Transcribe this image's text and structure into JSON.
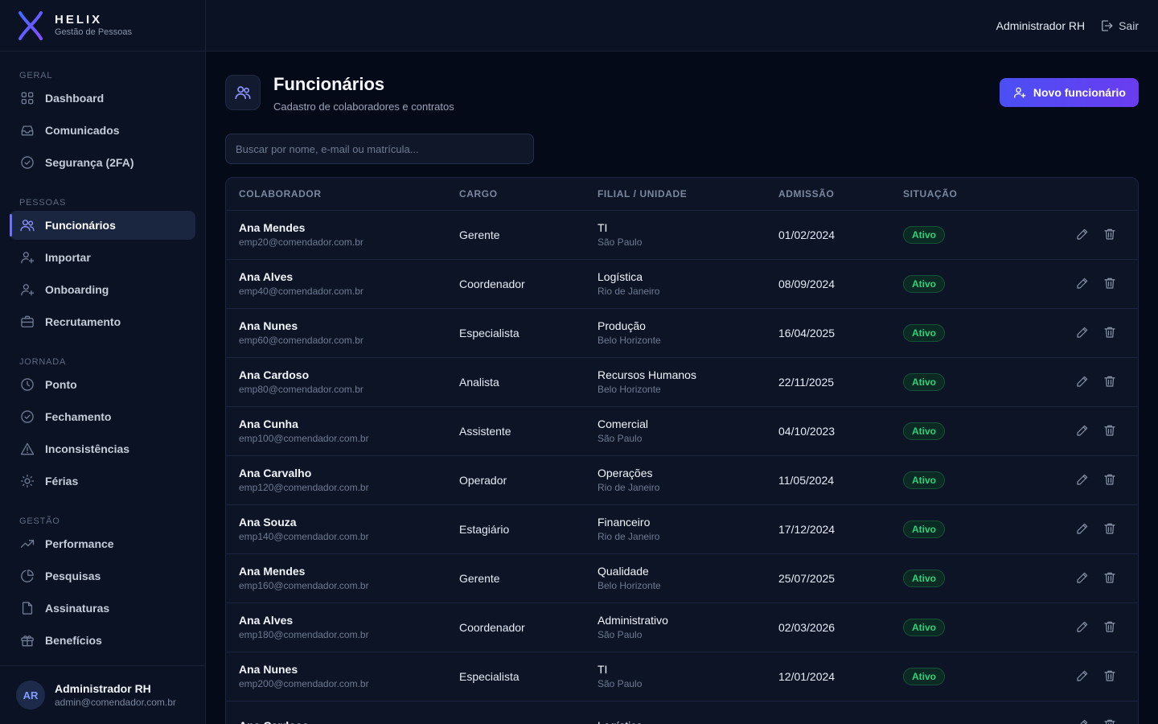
{
  "brand": {
    "name": "HELIX",
    "subtitle": "Gestão de Pessoas"
  },
  "topbar": {
    "user": "Administrador RH",
    "logout": "Sair"
  },
  "sidebar": {
    "sections": [
      {
        "label": "GERAL",
        "items": [
          {
            "label": "Dashboard",
            "icon": "grid-icon"
          },
          {
            "label": "Comunicados",
            "icon": "inbox-icon"
          },
          {
            "label": "Segurança (2FA)",
            "icon": "check-circle-icon"
          }
        ]
      },
      {
        "label": "PESSOAS",
        "items": [
          {
            "label": "Funcionários",
            "icon": "users-icon",
            "active": true
          },
          {
            "label": "Importar",
            "icon": "user-plus-icon"
          },
          {
            "label": "Onboarding",
            "icon": "user-plus-icon"
          },
          {
            "label": "Recrutamento",
            "icon": "briefcase-icon"
          }
        ]
      },
      {
        "label": "JORNADA",
        "items": [
          {
            "label": "Ponto",
            "icon": "clock-icon"
          },
          {
            "label": "Fechamento",
            "icon": "check-circle-icon"
          },
          {
            "label": "Inconsistências",
            "icon": "alert-triangle-icon"
          },
          {
            "label": "Férias",
            "icon": "sun-icon"
          }
        ]
      },
      {
        "label": "GESTÃO",
        "items": [
          {
            "label": "Performance",
            "icon": "trending-up-icon"
          },
          {
            "label": "Pesquisas",
            "icon": "pie-chart-icon"
          },
          {
            "label": "Assinaturas",
            "icon": "file-icon"
          },
          {
            "label": "Benefícios",
            "icon": "gift-icon"
          }
        ]
      }
    ],
    "user": {
      "initials": "AR",
      "name": "Administrador RH",
      "email": "admin@comendador.com.br"
    }
  },
  "page": {
    "title": "Funcionários",
    "subtitle": "Cadastro de colaboradores e contratos",
    "new_button": "Novo funcionário",
    "search_placeholder": "Buscar por nome, e-mail ou matrícula..."
  },
  "table": {
    "headers": [
      "COLABORADOR",
      "CARGO",
      "FILIAL / UNIDADE",
      "ADMISSÃO",
      "SITUAÇÃO"
    ],
    "rows": [
      {
        "name": "Ana Mendes",
        "email": "emp20@comendador.com.br",
        "role": "Gerente",
        "unit": "TI",
        "city": "São Paulo",
        "date": "01/02/2024",
        "status": "Ativo"
      },
      {
        "name": "Ana Alves",
        "email": "emp40@comendador.com.br",
        "role": "Coordenador",
        "unit": "Logística",
        "city": "Rio de Janeiro",
        "date": "08/09/2024",
        "status": "Ativo"
      },
      {
        "name": "Ana Nunes",
        "email": "emp60@comendador.com.br",
        "role": "Especialista",
        "unit": "Produção",
        "city": "Belo Horizonte",
        "date": "16/04/2025",
        "status": "Ativo"
      },
      {
        "name": "Ana Cardoso",
        "email": "emp80@comendador.com.br",
        "role": "Analista",
        "unit": "Recursos Humanos",
        "city": "Belo Horizonte",
        "date": "22/11/2025",
        "status": "Ativo"
      },
      {
        "name": "Ana Cunha",
        "email": "emp100@comendador.com.br",
        "role": "Assistente",
        "unit": "Comercial",
        "city": "São Paulo",
        "date": "04/10/2023",
        "status": "Ativo"
      },
      {
        "name": "Ana Carvalho",
        "email": "emp120@comendador.com.br",
        "role": "Operador",
        "unit": "Operações",
        "city": "Rio de Janeiro",
        "date": "11/05/2024",
        "status": "Ativo"
      },
      {
        "name": "Ana Souza",
        "email": "emp140@comendador.com.br",
        "role": "Estagiário",
        "unit": "Financeiro",
        "city": "Rio de Janeiro",
        "date": "17/12/2024",
        "status": "Ativo"
      },
      {
        "name": "Ana Mendes",
        "email": "emp160@comendador.com.br",
        "role": "Gerente",
        "unit": "Qualidade",
        "city": "Belo Horizonte",
        "date": "25/07/2025",
        "status": "Ativo"
      },
      {
        "name": "Ana Alves",
        "email": "emp180@comendador.com.br",
        "role": "Coordenador",
        "unit": "Administrativo",
        "city": "São Paulo",
        "date": "02/03/2026",
        "status": "Ativo"
      },
      {
        "name": "Ana Nunes",
        "email": "emp200@comendador.com.br",
        "role": "Especialista",
        "unit": "TI",
        "city": "São Paulo",
        "date": "12/01/2024",
        "status": "Ativo"
      },
      {
        "name": "Ana Cardoso",
        "email": "",
        "role": "",
        "unit": "Logística",
        "city": "",
        "date": "",
        "status": ""
      }
    ]
  },
  "colors": {
    "accent": "#6d73ff",
    "status_active": "#2fd27d",
    "background": "#050a18"
  }
}
